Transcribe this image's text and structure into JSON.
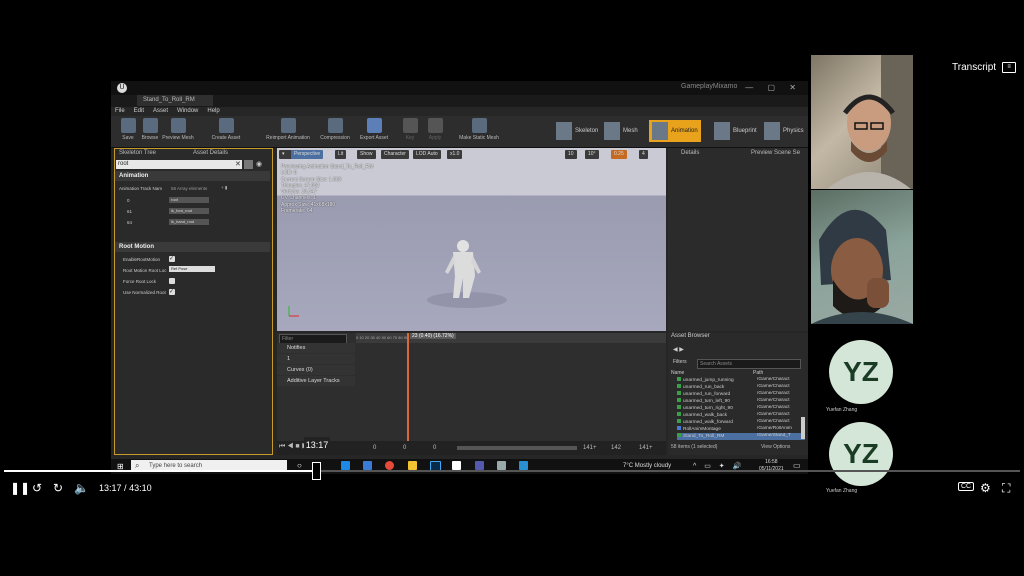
{
  "player": {
    "transcript_label": "Transcript",
    "current_time": "13:17",
    "separator": "/",
    "duration": "43:10",
    "tooltip_time": "13:17",
    "progress": 0.308,
    "cc_label": "CC"
  },
  "ue": {
    "window_game": "GameplayMixamo",
    "tab_label": "Stand_To_Roll_RM",
    "menu": [
      "File",
      "Edit",
      "Asset",
      "Window",
      "Help"
    ],
    "toolbar": [
      "Save",
      "Browse",
      "Preview Mesh",
      "Create Asset",
      "Reimport Animation",
      "Compression",
      "Export Asset",
      "Key",
      "Apply",
      "Make Static Mesh"
    ],
    "modes": [
      "Skeleton",
      "Mesh",
      "Animation",
      "Blueprint",
      "Physics"
    ],
    "left_tabs": [
      "Skeleton Tree",
      "Asset Details"
    ],
    "search_value": "root",
    "animation_section": "Animation",
    "track_names_label": "Animation Track Nam",
    "track_count": "58 Array elements",
    "tracks": [
      {
        "index": "0",
        "name": "root"
      },
      {
        "index": "61",
        "name": "ik_foot_root"
      },
      {
        "index": "64",
        "name": "ik_hand_root"
      }
    ],
    "root_motion_section": "Root Motion",
    "root_motion_props": [
      "EnableRootMotion",
      "Root Motion Root Loc",
      "Force Root Lock",
      "Use Normalized Root"
    ],
    "root_lock_value": "Ref Pose",
    "viewport_buttons": [
      "Perspective",
      "Lit",
      "Show",
      "Character",
      "LOD Auto",
      "x1.0"
    ],
    "snap_values": [
      "10",
      "10°",
      "0.25",
      "4"
    ],
    "viewport_info": [
      "Previewing Animation Stand_To_Roll_RM",
      "LOD: 0",
      "Current Screen Size: 1.060",
      "Triangles: 47,092",
      "Vertices: 26,347",
      "UV Channels: 1",
      "Approx Size: 41x68x180",
      "Framerate: 64"
    ],
    "right_tabs": [
      "Details",
      "Preview Scene Se"
    ],
    "timeline": {
      "filter_placeholder": "Filter",
      "rows": [
        "Notifies",
        "1",
        "Curves (0)",
        "Additive Layer Tracks"
      ],
      "frame_label": "23 (0.40) (16.72%)",
      "ruler": "0 10 20 30 40 50 60 70 80 90 100 110 120 130 140",
      "play_values": [
        "0",
        "0",
        "0",
        "141+",
        "142",
        "141+"
      ]
    },
    "asset_browser": {
      "title": "Asset Browser",
      "filters_label": "Filters",
      "search_placeholder": "Search Assets",
      "col_name": "Name",
      "col_path": "Path",
      "rows": [
        {
          "name": "unarmed_jump_running",
          "path": "/Game/Charact"
        },
        {
          "name": "unarmed_run_back",
          "path": "/Game/Charact"
        },
        {
          "name": "unarmed_run_forward",
          "path": "/Game/Charact"
        },
        {
          "name": "unarmed_turn_left_90",
          "path": "/Game/Charact"
        },
        {
          "name": "unarmed_turn_right_90",
          "path": "/Game/Charact"
        },
        {
          "name": "unarmed_walk_back",
          "path": "/Game/Charact"
        },
        {
          "name": "unarmed_walk_forward",
          "path": "/Game/Charact"
        },
        {
          "name": "RollAnimMontage",
          "path": "/Game/RollAnim"
        },
        {
          "name": "Stand_To_Roll_RM",
          "path": "/Game/Stand_T"
        }
      ],
      "footer": "58 items (1 selected)",
      "view_options": "View Options"
    }
  },
  "taskbar": {
    "search_placeholder": "Type here to search",
    "weather": "7°C  Mostly cloudy",
    "time": "16:58",
    "date": "05/11/2021"
  },
  "participants": [
    {
      "initials": "YZ",
      "name": "Yuefan Zhang"
    },
    {
      "initials": "YZ",
      "name": "Yuefan Zhang"
    }
  ]
}
